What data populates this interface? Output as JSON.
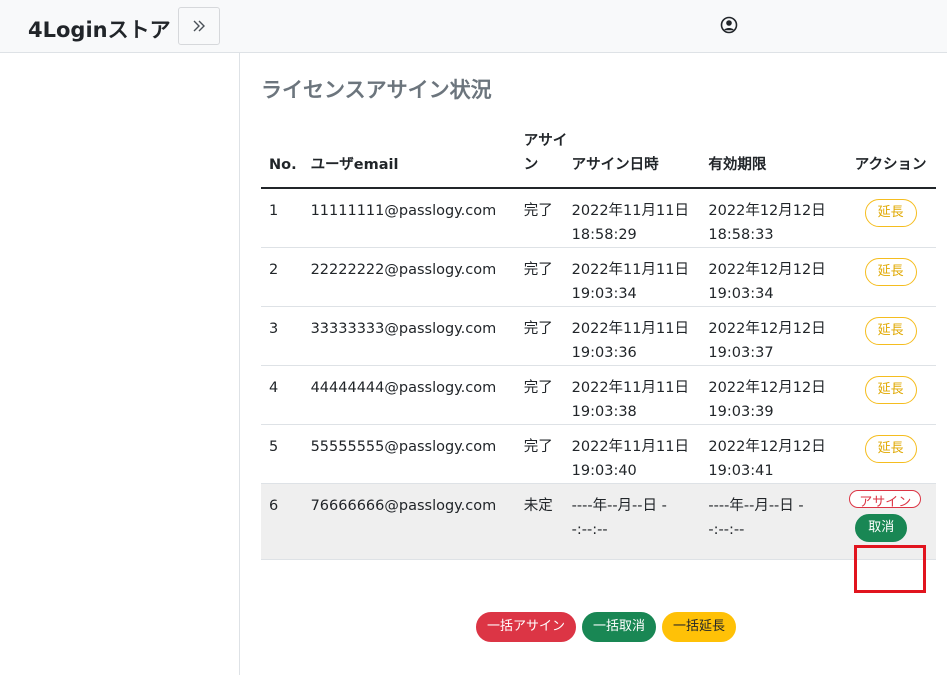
{
  "app": {
    "brand": "4Loginストア"
  },
  "header": {
    "toggle_icon": "double-chevron-right-icon",
    "user_icon": "user-circle-icon"
  },
  "page": {
    "title": "ライセンスアサイン状況"
  },
  "table": {
    "headers": {
      "no": "No.",
      "email": "ユーザemail",
      "assign": "アサイン",
      "assigned_at": "アサイン日時",
      "expires": "有効期限",
      "action": "アクション"
    },
    "rows": [
      {
        "no": "1",
        "email": "11111111@passlogy.com",
        "status": "完了",
        "assigned_date": "2022年11月11日",
        "assigned_time": "18:58:29",
        "exp_date": "2022年12月12日",
        "exp_time": "18:58:33",
        "action": "延長"
      },
      {
        "no": "2",
        "email": "22222222@passlogy.com",
        "status": "完了",
        "assigned_date": "2022年11月11日",
        "assigned_time": "19:03:34",
        "exp_date": "2022年12月12日",
        "exp_time": "19:03:34",
        "action": "延長"
      },
      {
        "no": "3",
        "email": "33333333@passlogy.com",
        "status": "完了",
        "assigned_date": "2022年11月11日",
        "assigned_time": "19:03:36",
        "exp_date": "2022年12月12日",
        "exp_time": "19:03:37",
        "action": "延長"
      },
      {
        "no": "4",
        "email": "44444444@passlogy.com",
        "status": "完了",
        "assigned_date": "2022年11月11日",
        "assigned_time": "19:03:38",
        "exp_date": "2022年12月12日",
        "exp_time": "19:03:39",
        "action": "延長"
      },
      {
        "no": "5",
        "email": "55555555@passlogy.com",
        "status": "完了",
        "assigned_date": "2022年11月11日",
        "assigned_time": "19:03:40",
        "exp_date": "2022年12月12日",
        "exp_time": "19:03:41",
        "action": "延長"
      }
    ],
    "pending_row": {
      "no": "6",
      "email": "76666666@passlogy.com",
      "status": "未定",
      "assigned_date": "----年--月--日 -",
      "assigned_time": "-:--:--",
      "exp_date": "----年--月--日 -",
      "exp_time": "-:--:--",
      "assign_label": "アサイン",
      "cancel_label": "取消"
    }
  },
  "bulk": {
    "assign_all": "一括アサイン",
    "cancel_all": "一括取消",
    "extend_all": "一括延長"
  },
  "colors": {
    "success": "#198754",
    "danger": "#dc3545",
    "warning": "#ffc107",
    "highlight": "#e1141e"
  }
}
